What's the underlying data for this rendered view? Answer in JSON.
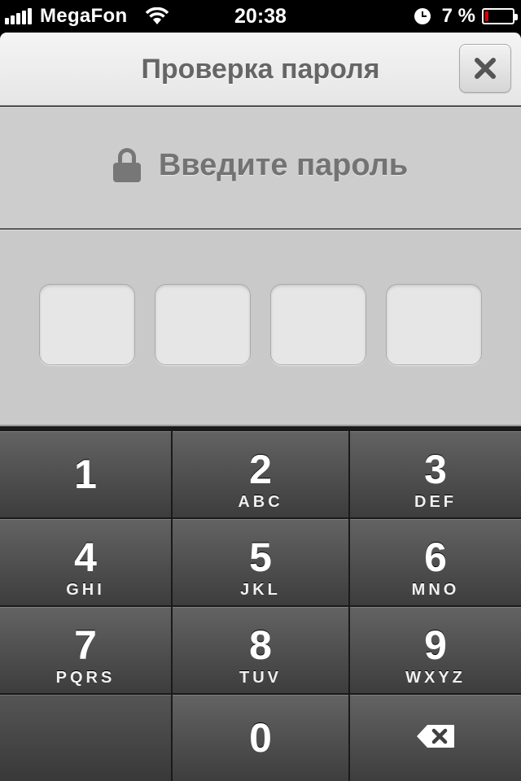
{
  "status_bar": {
    "carrier": "MegaFon",
    "time": "20:38",
    "battery_percent": "7 %",
    "battery_level": 0.07,
    "battery_color": "#e00000"
  },
  "nav": {
    "title": "Проверка пароля",
    "close_icon": "close-icon"
  },
  "prompt": {
    "icon": "lock-icon",
    "text": "Введите пароль"
  },
  "code": {
    "length": 4,
    "entered": 0
  },
  "keypad": {
    "keys": [
      {
        "digit": "1",
        "letters": ""
      },
      {
        "digit": "2",
        "letters": "ABC"
      },
      {
        "digit": "3",
        "letters": "DEF"
      },
      {
        "digit": "4",
        "letters": "GHI"
      },
      {
        "digit": "5",
        "letters": "JKL"
      },
      {
        "digit": "6",
        "letters": "MNO"
      },
      {
        "digit": "7",
        "letters": "PQRS"
      },
      {
        "digit": "8",
        "letters": "TUV"
      },
      {
        "digit": "9",
        "letters": "WXYZ"
      },
      {
        "digit": "0",
        "letters": ""
      }
    ],
    "backspace_icon": "backspace-icon"
  }
}
